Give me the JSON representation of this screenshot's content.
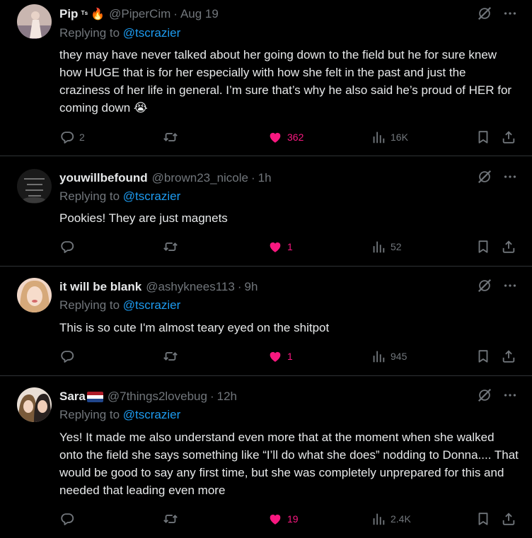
{
  "tweets": [
    {
      "name": "Pip",
      "badge": "ᵀˢ",
      "emoji": "🔥",
      "handle": "@PiperCim",
      "time": "Aug 19",
      "replying_prefix": "Replying to ",
      "replying_to": "@tscrazier",
      "text": "they may have never talked about her going down to the field but he for sure knew how HUGE that is for her especially with how she felt in the past and just the craziness of her life in general. I’m sure that’s why he also said he’s proud of HER for coming down 😭",
      "replies": "2",
      "retweets": "",
      "likes": "362",
      "views": "16K",
      "liked": true
    },
    {
      "name": "youwillbefound",
      "handle": "@brown23_nicole",
      "time": "1h",
      "replying_prefix": "Replying to ",
      "replying_to": "@tscrazier",
      "text": "Pookies! They are just magnets",
      "replies": "",
      "retweets": "",
      "likes": "1",
      "views": "52",
      "liked": true
    },
    {
      "name": "it will be blank",
      "handle": "@ashyknees113",
      "time": "9h",
      "replying_prefix": "Replying to ",
      "replying_to": "@tscrazier",
      "text": "This is so cute I'm almost teary eyed on the shitpot",
      "replies": "",
      "retweets": "",
      "likes": "1",
      "views": "945",
      "liked": true
    },
    {
      "name": "Sara",
      "handle": "@7things2lovebug",
      "time": "12h",
      "replying_prefix": "Replying to ",
      "replying_to": "@tscrazier",
      "text": "Yes! It made me also understand even more that at the moment when she walked onto the field she says something like “I’ll do what she does” nodding to Donna....  That would be good to say any first time, but she was completely unprepared for this and needed that leading even more",
      "replies": "",
      "retweets": "",
      "likes": "19",
      "views": "2.4K",
      "liked": true
    }
  ],
  "separator": "·",
  "colors": {
    "background": "#000000",
    "text": "#e7e9ea",
    "muted": "#71767b",
    "link": "#1d9bf0",
    "like": "#f91880",
    "divider": "#2f3336"
  },
  "icons": {
    "reply": "reply-icon",
    "retweet": "retweet-icon",
    "like": "heart-icon",
    "views": "views-icon",
    "bookmark": "bookmark-icon",
    "share": "share-icon",
    "grok": "grok-icon",
    "more": "more-icon",
    "flag": "netherlands-flag"
  }
}
